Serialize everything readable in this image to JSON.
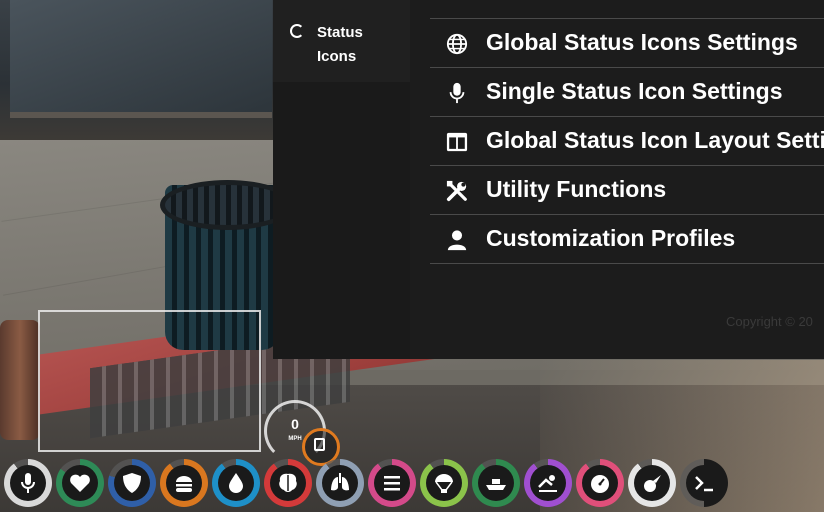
{
  "menu": {
    "sidebar": {
      "items": [
        {
          "label": "Status Icons",
          "icon": "spinner-icon",
          "active": true
        }
      ]
    },
    "items": [
      {
        "label": "Global Status Icons Settings",
        "icon": "globe-icon"
      },
      {
        "label": "Single Status Icon Settings",
        "icon": "microphone-icon"
      },
      {
        "label": "Global Status Icon Layout Settin",
        "icon": "layout-columns-icon"
      },
      {
        "label": "Utility Functions",
        "icon": "tools-icon"
      },
      {
        "label": "Customization Profiles",
        "icon": "user-icon"
      }
    ],
    "copyright": "Copyright © 20"
  },
  "speedometer": {
    "value": "0",
    "unit": "MPH"
  },
  "status_icons": [
    {
      "name": "voice",
      "icon": "microphone-icon",
      "ring_color": "#d9d9d9",
      "level": 0.9
    },
    {
      "name": "health",
      "icon": "heart-icon",
      "ring_color": "#2e8b57",
      "level": 0.85
    },
    {
      "name": "armor",
      "icon": "shield-icon",
      "ring_color": "#2f5fa8",
      "level": 0.8
    },
    {
      "name": "hunger",
      "icon": "burger-icon",
      "ring_color": "#d9771f",
      "level": 0.9
    },
    {
      "name": "thirst",
      "icon": "droplet-icon",
      "ring_color": "#1e90c8",
      "level": 0.9
    },
    {
      "name": "stress",
      "icon": "brain-icon",
      "ring_color": "#d43a3a",
      "level": 0.9
    },
    {
      "name": "oxygen",
      "icon": "lungs-icon",
      "ring_color": "#8f9fb3",
      "level": 0.9
    },
    {
      "name": "stamina",
      "icon": "bars-icon",
      "ring_color": "#d44a8a",
      "level": 0.9
    },
    {
      "name": "parachute",
      "icon": "parachute-icon",
      "ring_color": "#8bc34a",
      "level": 0.9
    },
    {
      "name": "boat",
      "icon": "ship-icon",
      "ring_color": "#2f8a4f",
      "level": 0.9
    },
    {
      "name": "swimming",
      "icon": "swimmer-icon",
      "ring_color": "#a04fd0",
      "level": 0.9
    },
    {
      "name": "speed",
      "icon": "gauge-icon",
      "ring_color": "#e04f7a",
      "level": 0.9
    },
    {
      "name": "nitro",
      "icon": "comet-icon",
      "ring_color": "#e6e6e6",
      "level": 0.9
    },
    {
      "name": "dev-mode",
      "icon": "terminal-icon",
      "ring_color": "#1a1a1a",
      "level": 0.5
    }
  ]
}
